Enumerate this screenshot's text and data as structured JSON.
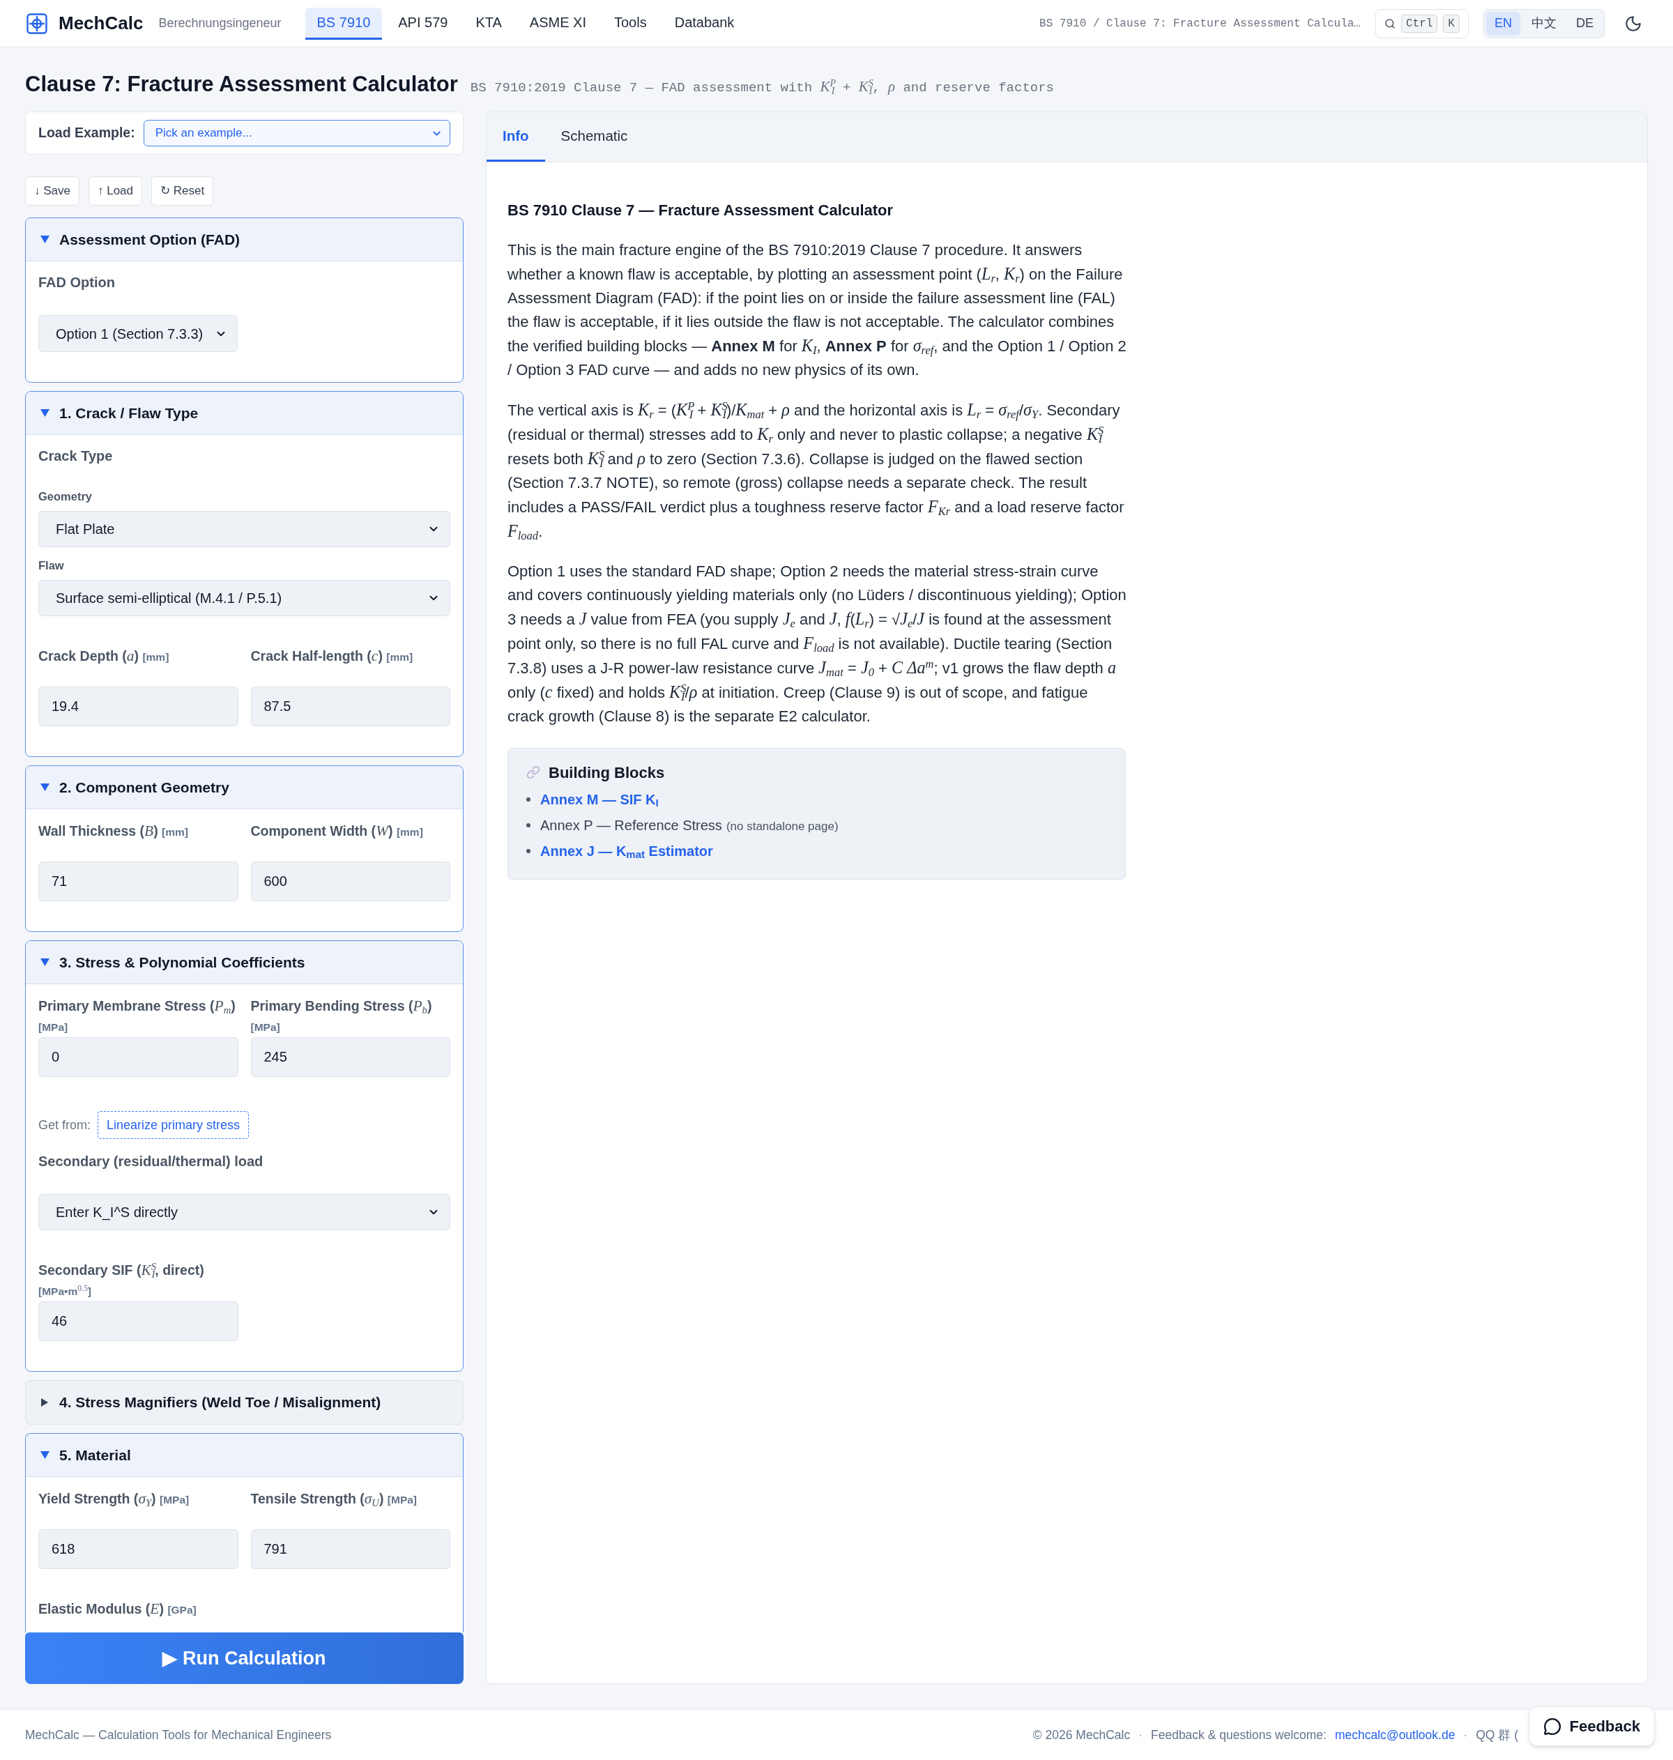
{
  "header": {
    "logo_text": "MechCalc",
    "tagline": "Berechnungsingeneur",
    "nav": [
      {
        "label": "BS 7910",
        "selected": true
      },
      {
        "label": "API 579",
        "selected": false
      },
      {
        "label": "KTA",
        "selected": false
      },
      {
        "label": "ASME XI",
        "selected": false
      },
      {
        "label": "Tools",
        "selected": false
      },
      {
        "label": "Databank",
        "selected": false
      }
    ],
    "breadcrumb": "BS 7910 / Clause 7: Fracture Assessment Calcula…",
    "search_keys": [
      "Ctrl",
      "K"
    ],
    "languages": [
      {
        "label": "EN",
        "selected": true
      },
      {
        "label": "中文",
        "selected": false
      },
      {
        "label": "DE",
        "selected": false
      }
    ]
  },
  "page": {
    "title": "Clause 7: Fracture Assessment Calculator",
    "subtitle": "BS 7910:2019 Clause 7 — FAD assessment with *K*$^{P}$$_{I}$ + *K*$^{S}$$_{I}$, *ρ* and reserve factors"
  },
  "inputs_panel": {
    "load_example": {
      "label": "Load Example:",
      "value": "Pick an example..."
    },
    "file_buttons": [
      "↓ Save",
      "↑ Load",
      "↻ Reset"
    ],
    "sections": [
      {
        "title": "Assessment Option (FAD)",
        "expanded": true,
        "items": [
          {
            "kind": "heading",
            "text": "FAD Option"
          },
          {
            "kind": "compact_select",
            "value": "Option 1 (Section 7.3.3)"
          }
        ]
      },
      {
        "title": "1. Crack / Flaw Type",
        "expanded": true,
        "items": [
          {
            "kind": "heading",
            "text": "Crack Type"
          },
          {
            "kind": "select",
            "label": "Geometry",
            "value": "Flat Plate"
          },
          {
            "kind": "select",
            "label": "Flaw",
            "value": "Surface semi-elliptical (M.4.1 / P.5.1)"
          },
          {
            "kind": "fields",
            "fields": [
              {
                "label": "Crack Depth (*a*)",
                "unit": "[mm]",
                "value": "19.4"
              },
              {
                "label": "Crack Half-length (*c*)",
                "unit": "[mm]",
                "value": "87.5"
              }
            ]
          }
        ]
      },
      {
        "title": "2. Component Geometry",
        "expanded": true,
        "items": [
          {
            "kind": "fields",
            "fields": [
              {
                "label": "Wall Thickness (*B*)",
                "unit": "[mm]",
                "value": "71"
              },
              {
                "label": "Component Width (*W*)",
                "unit": "[mm]",
                "value": "600"
              }
            ]
          }
        ]
      },
      {
        "title": "3. Stress & Polynomial Coefficients",
        "expanded": true,
        "items": [
          {
            "kind": "fields",
            "fields": [
              {
                "label": "Primary Membrane Stress (*P*$_{m}$)",
                "unit": "[MPa]",
                "value": "0"
              },
              {
                "label": "Primary Bending Stress (*P*$_{b}$)",
                "unit": "[MPa]",
                "value": "245"
              }
            ]
          },
          {
            "kind": "source_link",
            "prefix": "Get from:",
            "link": "Linearize primary stress"
          },
          {
            "kind": "heading",
            "text": "Secondary (residual/thermal) load"
          },
          {
            "kind": "select",
            "value": "Enter K_I^S directly"
          },
          {
            "kind": "fields",
            "fields": [
              {
                "label": "Secondary SIF (*K*$^{S}$$_{I}$, direct)",
                "unit": "[MPa•m$^{0.5}$]",
                "value": "46"
              }
            ]
          }
        ]
      },
      {
        "title": "4. Stress Magnifiers (Weld Toe / Misalignment)",
        "expanded": false
      },
      {
        "title": "5. Material",
        "expanded": true,
        "items": [
          {
            "kind": "fields",
            "fields": [
              {
                "label": "Yield Strength (*σ*$_{Y}$)",
                "unit": "[MPa]",
                "value": "618"
              },
              {
                "label": "Tensile Strength (*σ*$_{U}$)",
                "unit": "[MPa]",
                "value": "791"
              }
            ]
          },
          {
            "kind": "fields",
            "fields": [
              {
                "label": "Elastic Modulus (*E*)",
                "unit": "[GPa]"
              }
            ]
          }
        ]
      }
    ],
    "run_button": "▶ Run Calculation"
  },
  "info_panel": {
    "tabs": [
      {
        "label": "Info",
        "selected": true
      },
      {
        "label": "Schematic",
        "selected": false
      }
    ],
    "heading": "BS 7910 Clause 7 — Fracture Assessment Calculator",
    "paragraphs": [
      "This is the main fracture engine of the BS 7910:2019 Clause 7 procedure. It answers whether a known flaw is acceptable, by plotting an assessment point (*L*$_{r}$, *K*$_{r}$) on the Failure Assessment Diagram (FAD): if the point lies on or inside the failure assessment line (FAL) the flaw is acceptable, if it lies outside the flaw is not acceptable. The calculator combines the verified building blocks — **Annex M** for *K*$_{I}$, **Annex P** for *σ*$_{ref}$, and the Option 1 / Option 2 / Option 3 FAD curve — and adds no new physics of its own.",
      "The vertical axis is *K*$_{r}$ = (*K*$^{P}$$_{I}$ + *K*$^{S}$$_{I}$)/*K*$_{mat}$ + *ρ* and the horizontal axis is *L*$_{r}$ = *σ*$_{ref}$/*σ*$_{Y}$. Secondary (residual or thermal) stresses add to *K*$_{r}$ only and never to plastic collapse; a negative *K*$^{S}$$_{I}$ resets both *K*$^{S}$$_{I}$ and *ρ* to zero (Section 7.3.6). Collapse is judged on the flawed section (Section 7.3.7 NOTE), so remote (gross) collapse needs a separate check. The result includes a PASS/FAIL verdict plus a toughness reserve factor *F*$_{Kr}$ and a load reserve factor *F*$_{load}$.",
      "Option 1 uses the standard FAD shape; Option 2 needs the material stress-strain curve and covers continuously yielding materials only (no Lüders / discontinuous yielding); Option 3 needs a *J* value from FEA (you supply *J*$_{e}$ and *J*, *f*(*L*$_{r}$) = √*J*$_{e}$/*J* is found at the assessment point only, so there is no full FAL curve and *F*$_{load}$ is not available). Ductile tearing (Section 7.3.8) uses a J-R power-law resistance curve *J*$_{mat}$ = *J*$_{0}$ + *C* *Δa*$^{m}$; v1 grows the flaw depth *a* only (*c* fixed) and holds *K*$^{S}$$_{I}$/*ρ* at initiation. Creep (Clause 9) is out of scope, and fatigue crack growth (Clause 8) is the separate E2 calculator."
    ],
    "building_blocks": {
      "title": "Building Blocks",
      "items": [
        {
          "kind": "link",
          "text": "Annex M — SIF K$_{I}$"
        },
        {
          "kind": "text",
          "text": "Annex P — Reference Stress",
          "note": "(no standalone page)"
        },
        {
          "kind": "link",
          "text": "Annex J — K$_{mat}$ Estimator"
        }
      ]
    }
  },
  "footer": {
    "tagline": "MechCalc — Calculation Tools for Mechanical Engineers",
    "items": [
      {
        "kind": "text",
        "text": "© 2026 MechCalc"
      },
      {
        "kind": "separator",
        "text": "·"
      },
      {
        "kind": "text",
        "text": "Feedback & questions welcome:"
      },
      {
        "kind": "link",
        "text": "mechcalc@outlook.de"
      },
      {
        "kind": "separator",
        "text": "·"
      },
      {
        "kind": "text",
        "text": "QQ 群 ("
      }
    ]
  },
  "feedback_button": "Feedback"
}
